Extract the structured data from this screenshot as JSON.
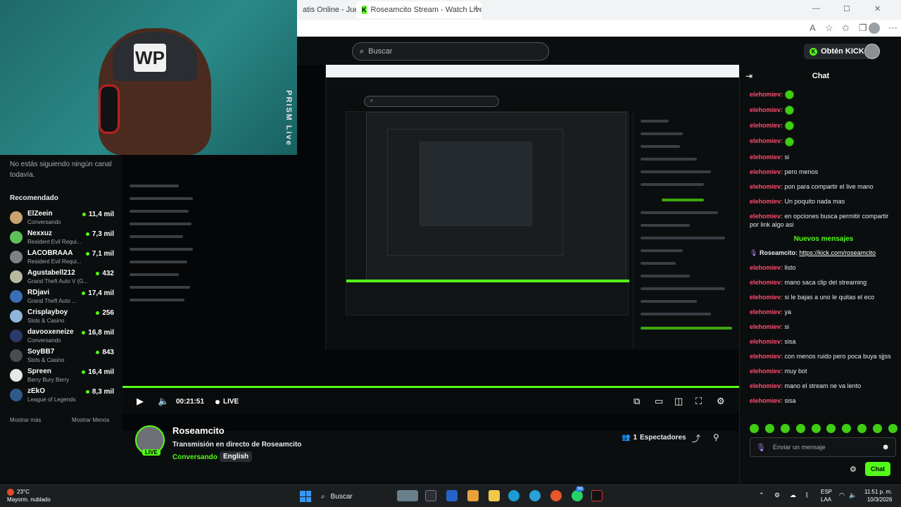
{
  "browser": {
    "tabs": [
      {
        "label": "atis Online - Jueg",
        "close": "✕"
      },
      {
        "label": "Roseamcito Stream - Watch Live o",
        "close": "✕"
      }
    ],
    "new_tab": "+",
    "window": {
      "minimize": "—",
      "maximize": "☐",
      "close": "✕"
    }
  },
  "webcam": {
    "overlay_text": "PRISM Live",
    "cap_logo": "WP"
  },
  "header": {
    "search_placeholder": "Buscar",
    "get_kicks": "Obtén KICKs"
  },
  "sidebar": {
    "no_follow": "No estás siguiendo ningún canal todavía.",
    "recommended_title": "Recomendado",
    "channels": [
      {
        "name": "ElZeein",
        "category": "Conversando",
        "viewers": "11,4 mil"
      },
      {
        "name": "Nexxuz",
        "category": "Resident Evil Requi...",
        "viewers": "7,3 mil"
      },
      {
        "name": "LACOBRAAA",
        "category": "Resident Evil Requi...",
        "viewers": "7,1 mil"
      },
      {
        "name": "Agustabell212",
        "category": "Grand Theft Auto V (G...",
        "viewers": "432"
      },
      {
        "name": "RDjavi",
        "category": "Grand Theft Auto ...",
        "viewers": "17,4 mil"
      },
      {
        "name": "Crisplayboy",
        "category": "Slots & Casino",
        "viewers": "256"
      },
      {
        "name": "davooxeneize",
        "category": "Conversando",
        "viewers": "16,8 mil"
      },
      {
        "name": "SoyBB7",
        "category": "Slots & Casino",
        "viewers": "843"
      },
      {
        "name": "Spreen",
        "category": "Berry Bury Berry",
        "viewers": "16,4 mil"
      },
      {
        "name": "zEkO",
        "category": "League of Legends",
        "viewers": "8,3 mil"
      }
    ],
    "show_more": "Mostrar más",
    "show_less": "Mostrar Menos"
  },
  "player": {
    "time": "00:21:51",
    "live_label": "LIVE",
    "progress": 1.0
  },
  "stream": {
    "channel": "Roseamcito",
    "live_badge": "LIVE",
    "title": "Transmisión en directo de Roseamcito",
    "category": "Conversando",
    "language": "English",
    "viewers_count": "1",
    "viewers_label": "Espectadores"
  },
  "chat": {
    "title": "Chat",
    "messages": [
      {
        "user": "elehomiev:",
        "text": "",
        "emote": true
      },
      {
        "user": "elehomiev:",
        "text": "",
        "emote": true
      },
      {
        "user": "elehomiev:",
        "text": "",
        "emote": true
      },
      {
        "user": "elehomiev:",
        "text": "",
        "emote": true
      },
      {
        "user": "elehomiev:",
        "text": "si"
      },
      {
        "user": "elehomiev:",
        "text": "pero menos"
      },
      {
        "user": "elehomiev:",
        "text": "pon para compartir el live mano"
      },
      {
        "user": "elehomiev:",
        "text": "Un poquito nada mas"
      },
      {
        "user": "elehomiev:",
        "text": "en opciones busca permitir compartir por link algo asi"
      }
    ],
    "new_messages": "Nuevos mensajes",
    "messages_after": [
      {
        "user": "Roseamcito:",
        "text": "https://kick.com/roseamcito",
        "link": true
      },
      {
        "user": "elehomiev:",
        "text": "listo"
      },
      {
        "user": "elehomiev:",
        "text": "mano saca clip del streaming"
      },
      {
        "user": "elehomiev:",
        "text": "si le bajas a uno le quitas el eco"
      },
      {
        "user": "elehomiev:",
        "text": "ya"
      },
      {
        "user": "elehomiev:",
        "text": "si"
      },
      {
        "user": "elehomiev:",
        "text": "sisa"
      },
      {
        "user": "elehomiev:",
        "text": "con menos ruido pero poca buya sjjss"
      },
      {
        "user": "elehomiev:",
        "text": "muy bot"
      },
      {
        "user": "elehomiev:",
        "text": "mano el stream ne va lento"
      },
      {
        "user": "elehomiev:",
        "text": "sisa"
      }
    ],
    "input_placeholder": "Enviar un mensaje",
    "send_label": "Chat"
  },
  "taskbar": {
    "temp": "23°C",
    "weather": "Mayorm. nublado",
    "search": "Buscar",
    "lang_1": "ESP",
    "lang_2": "LAA",
    "time": "11:51 p. m.",
    "date": "10/3/2026",
    "badge_count": "96"
  },
  "colors": {
    "accent": "#53fc18",
    "username": "#ff4d6d",
    "background": "#0b0e0f"
  }
}
